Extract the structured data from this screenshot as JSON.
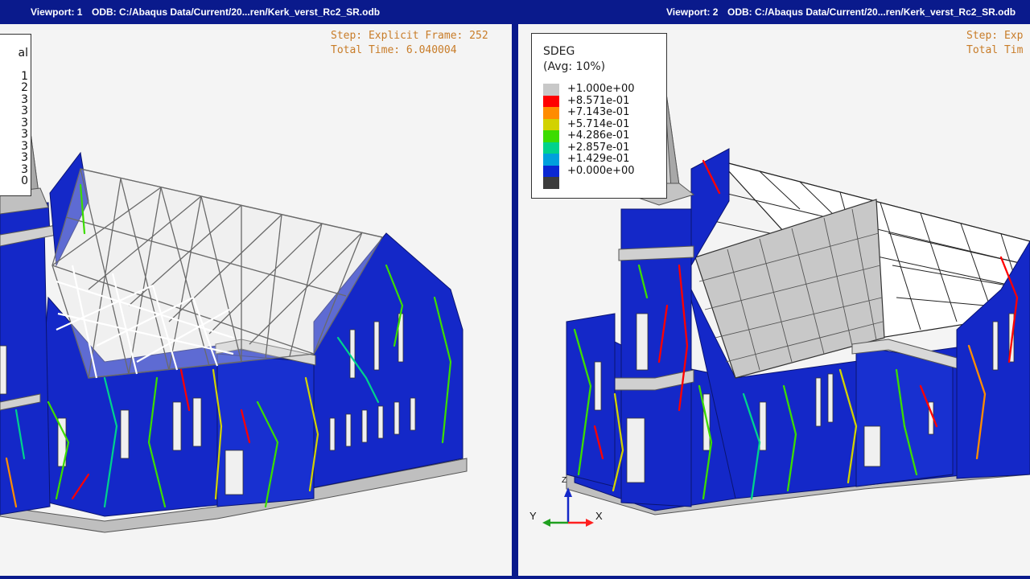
{
  "viewports": [
    {
      "id": 1,
      "label": "Viewport: 1",
      "odb": "ODB: C:/Abaqus Data/Current/20...ren/Kerk_verst_Rc2_SR.odb",
      "step_line1": "Step: Explicit Frame: 252",
      "step_line2": "Total Time: 6.040004",
      "legend_fragment": [
        "al",
        "1",
        "2",
        "3",
        "3",
        "3",
        "3",
        "3",
        "3",
        "3",
        "0"
      ]
    },
    {
      "id": 2,
      "label": "Viewport: 2",
      "odb": "ODB: C:/Abaqus Data/Current/20...ren/Kerk_verst_Rc2_SR.odb",
      "step_line1": "Step: Exp",
      "step_line2": "Total Tim",
      "legend": {
        "title": "SDEG",
        "subtitle": "(Avg: 10%)",
        "entries": [
          {
            "value": "+1.000e+00",
            "color": "#c8c8c8"
          },
          {
            "value": "+8.571e-01",
            "color": "#ff0000"
          },
          {
            "value": "+7.143e-01",
            "color": "#ff8c00"
          },
          {
            "value": "+5.714e-01",
            "color": "#d2d200"
          },
          {
            "value": "+4.286e-01",
            "color": "#3cdc00"
          },
          {
            "value": "+2.857e-01",
            "color": "#00d28c"
          },
          {
            "value": "+1.429e-01",
            "color": "#00a0dc"
          },
          {
            "value": "+0.000e+00",
            "color": "#0a28d2"
          }
        ],
        "bottom_color": "#3c3c3c"
      },
      "triad": {
        "y": "Y",
        "x": "X",
        "z": "Z"
      }
    }
  ],
  "colors": {
    "frame": "#0a1a8c",
    "background": "#f4f4f4",
    "wall": "#1428c8",
    "roof": "#c8c8c8",
    "damage_high": "#ff0000",
    "damage_mid": "#3cdc00"
  }
}
